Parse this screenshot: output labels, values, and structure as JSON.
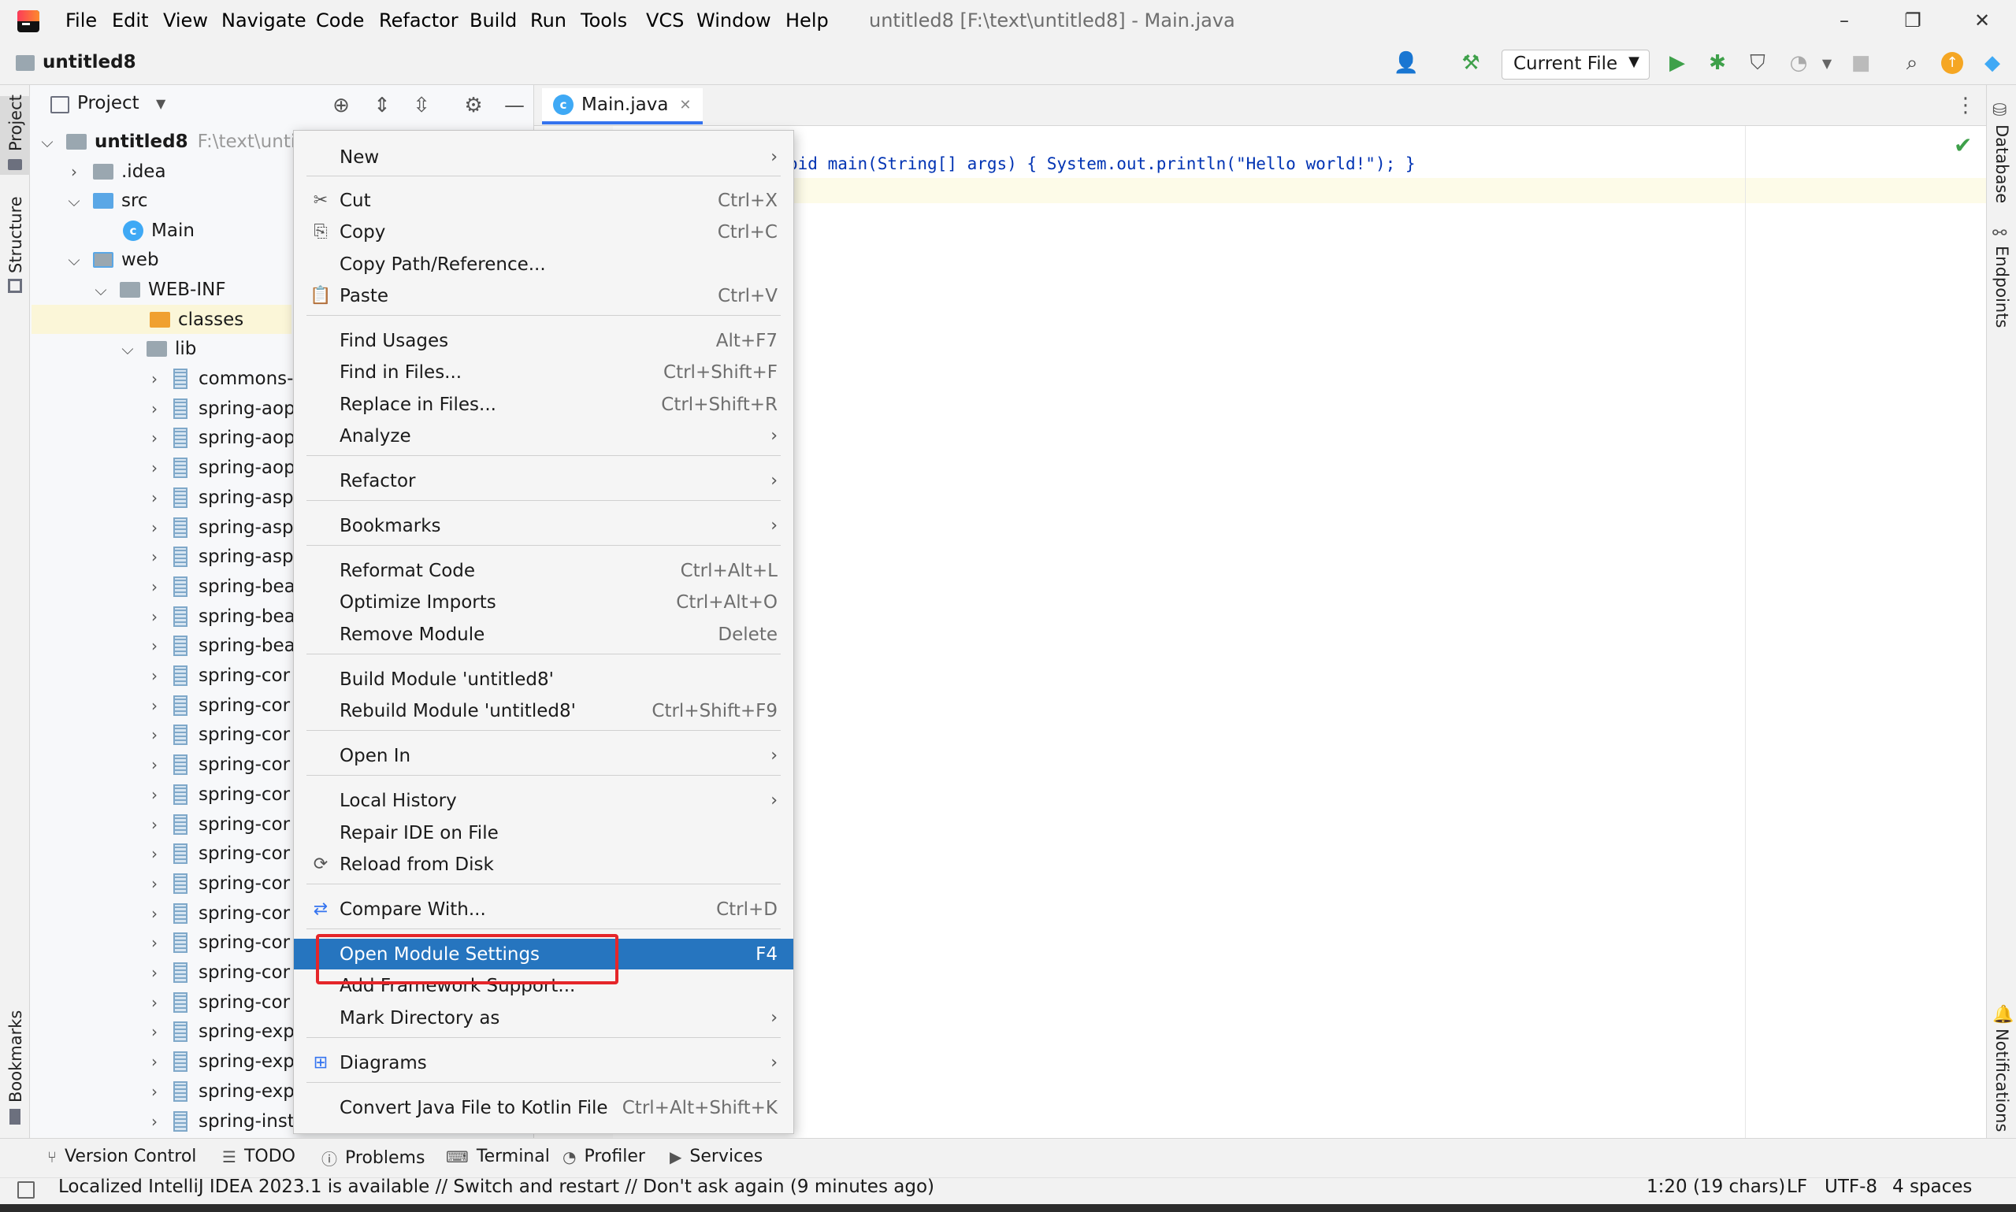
{
  "app": {
    "window_title": "untitled8 [F:\\text\\untitled8] - Main.java",
    "menu": [
      "File",
      "Edit",
      "View",
      "Navigate",
      "Code",
      "Refactor",
      "Build",
      "Run",
      "Tools",
      "VCS",
      "Window",
      "Help"
    ]
  },
  "navbar": {
    "project_name": "untitled8",
    "run_config": "Current File"
  },
  "side_tools": {
    "left": [
      "Project",
      "Structure",
      "Bookmarks"
    ],
    "right": [
      "Database",
      "Endpoints",
      "Notifications"
    ]
  },
  "project_panel": {
    "title": "Project",
    "root": {
      "name": "untitled8",
      "path": "F:\\text\\untitl"
    },
    "nodes": [
      {
        "name": ".idea"
      },
      {
        "name": "src"
      },
      {
        "name": "Main"
      },
      {
        "name": "web"
      },
      {
        "name": "WEB-INF"
      },
      {
        "name": "classes"
      },
      {
        "name": "lib"
      }
    ],
    "jars": [
      "commons-",
      "spring-aop",
      "spring-aop",
      "spring-aop",
      "spring-asp",
      "spring-asp",
      "spring-asp",
      "spring-bea",
      "spring-bea",
      "spring-bea",
      "spring-cor",
      "spring-cor",
      "spring-cor",
      "spring-cor",
      "spring-cor",
      "spring-cor",
      "spring-cor",
      "spring-cor",
      "spring-cor",
      "spring-cor",
      "spring-cor",
      "spring-cor",
      "spring-exp",
      "spring-exp",
      "spring-exp",
      "spring-inst"
    ]
  },
  "editor": {
    "tab_name": "Main.java",
    "code": "oid main(String[] args) { System.out.println(\"Hello world!\"); }"
  },
  "context_menu": {
    "new": "New",
    "cut": {
      "label": "Cut",
      "shortcut": "Ctrl+X"
    },
    "copy": {
      "label": "Copy",
      "shortcut": "Ctrl+C"
    },
    "copy_path": "Copy Path/Reference...",
    "paste": {
      "label": "Paste",
      "shortcut": "Ctrl+V"
    },
    "find_usages": {
      "label": "Find Usages",
      "shortcut": "Alt+F7"
    },
    "find_in_files": {
      "label": "Find in Files...",
      "shortcut": "Ctrl+Shift+F"
    },
    "replace_in_files": {
      "label": "Replace in Files...",
      "shortcut": "Ctrl+Shift+R"
    },
    "analyze": "Analyze",
    "refactor": "Refactor",
    "bookmarks": "Bookmarks",
    "reformat_code": {
      "label": "Reformat Code",
      "shortcut": "Ctrl+Alt+L"
    },
    "optimize_imports": {
      "label": "Optimize Imports",
      "shortcut": "Ctrl+Alt+O"
    },
    "remove_module": {
      "label": "Remove Module",
      "shortcut": "Delete"
    },
    "build_module": "Build Module 'untitled8'",
    "rebuild_module": {
      "label": "Rebuild Module 'untitled8'",
      "shortcut": "Ctrl+Shift+F9"
    },
    "open_in": "Open In",
    "local_history": "Local History",
    "repair_ide": "Repair IDE on File",
    "reload_from_disk": "Reload from Disk",
    "compare_with": {
      "label": "Compare With...",
      "shortcut": "Ctrl+D"
    },
    "open_module_settings": {
      "label": "Open Module Settings",
      "shortcut": "F4"
    },
    "add_framework_support": "Add Framework Support...",
    "mark_directory_as": "Mark Directory as",
    "diagrams": "Diagrams",
    "convert_java_to_kotlin": {
      "label": "Convert Java File to Kotlin File",
      "shortcut": "Ctrl+Alt+Shift+K"
    }
  },
  "bottom_tabs": [
    "Version Control",
    "TODO",
    "Problems",
    "Terminal",
    "Profiler",
    "Services"
  ],
  "status_bar": {
    "message": "Localized IntelliJ IDEA 2023.1 is available // Switch and restart // Don't ask again (9 minutes ago)",
    "position": "1:20 (19 chars)",
    "line_sep": "LF",
    "encoding": "UTF-8",
    "indent": "4 spaces"
  },
  "colors": {
    "selection": "#2675bf",
    "highlight_box": "#e5262a",
    "run_green": "#3ea04a",
    "update_orange": "#f5a623"
  }
}
